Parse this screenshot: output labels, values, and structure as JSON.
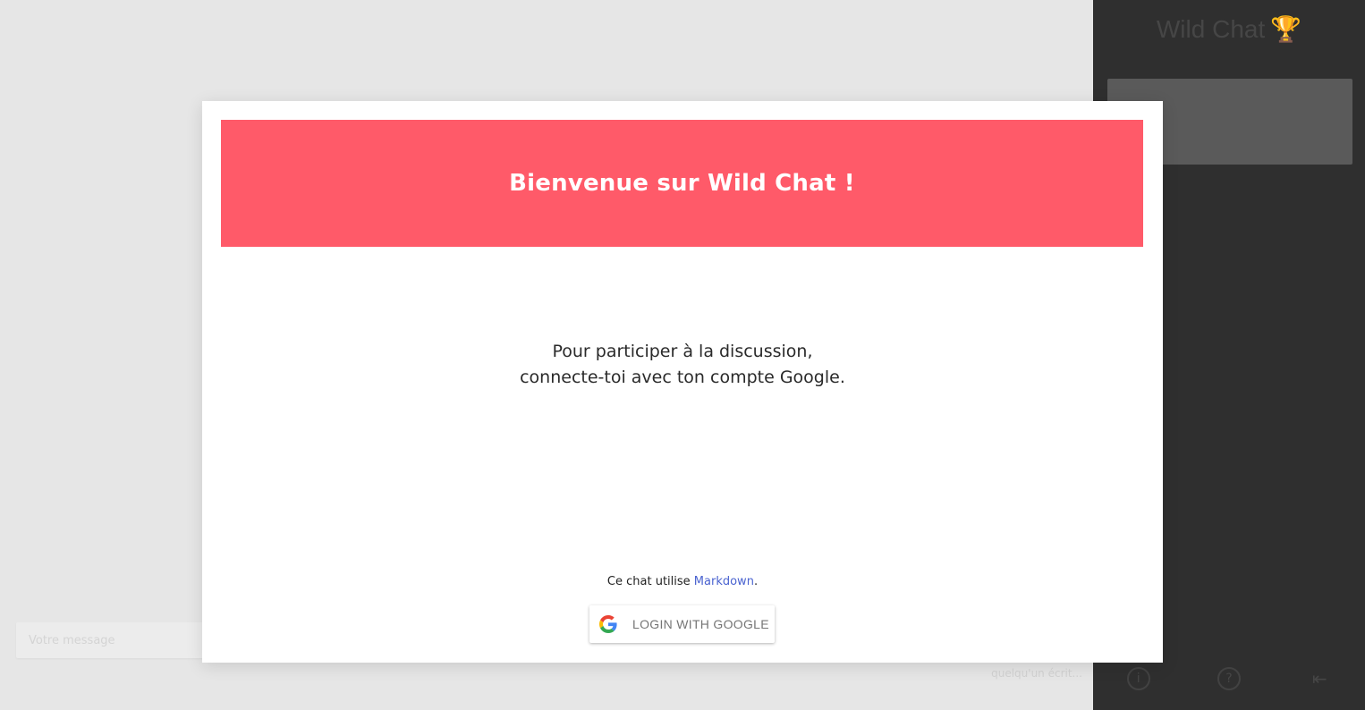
{
  "background": {
    "chat_input_placeholder": "Votre message",
    "typing_hint": "quelqu'un écrit..."
  },
  "sidebar": {
    "title": "Wild Chat",
    "trophy_glyph": "🏆",
    "footer_icons": [
      "info-icon",
      "help-icon",
      "logout-icon"
    ]
  },
  "modal": {
    "title": "Bienvenue sur Wild Chat !",
    "message_line1": "Pour participer à la discussion,",
    "message_line2": "connecte-toi avec ton compte Google.",
    "markdown_prefix": "Ce chat utilise ",
    "markdown_link": "Markdown",
    "markdown_suffix": ".",
    "login_button": "LOGIN WITH GOOGLE"
  },
  "colors": {
    "header_bg": "#ff5a69",
    "sidebar_bg": "#2f2f2f",
    "link": "#4a63d0"
  }
}
